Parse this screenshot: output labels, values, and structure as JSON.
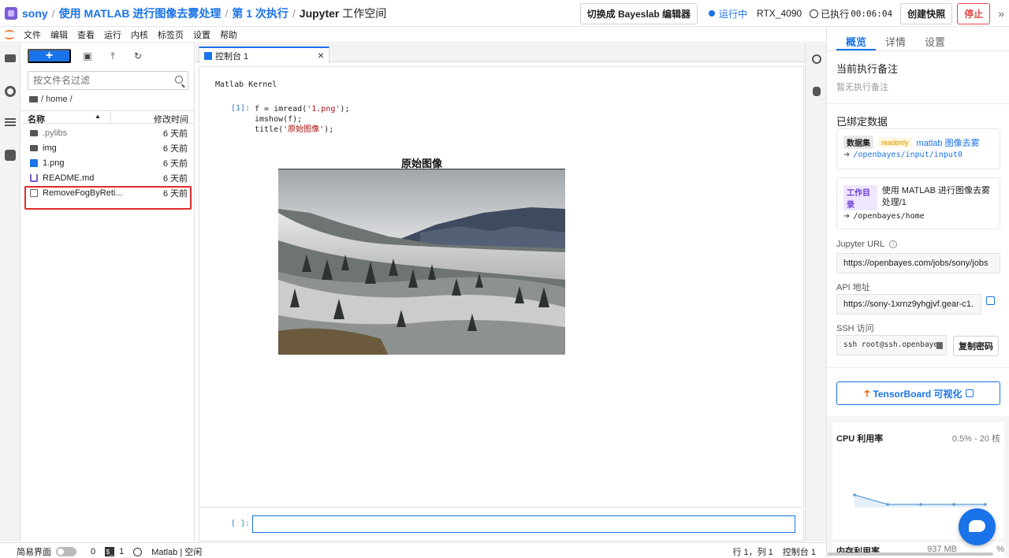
{
  "topbar": {
    "breadcrumb": {
      "user": "sony",
      "sep": "/",
      "project": "使用 MATLAB 进行图像去雾处理",
      "run": "第 1 次执行",
      "workspace_bold": "Jupyter",
      "workspace_rest": " 工作空间"
    },
    "switch_editor": "切换成 Bayeslab 编辑器",
    "status": "运行中",
    "gpu": "RTX_4090",
    "elapsed_label": "已执行",
    "elapsed_time": "00:06:04",
    "snapshot_btn": "创建快照",
    "stop_btn": "停止",
    "collapse": "»"
  },
  "menubar": [
    "文件",
    "编辑",
    "查看",
    "运行",
    "内核",
    "标签页",
    "设置",
    "帮助"
  ],
  "filebrowser": {
    "new_btn": "+",
    "search_placeholder": "按文件名过滤",
    "path": "/ home /",
    "col_name": "名称",
    "col_modified": "修改时间",
    "sort_glyph": "▲",
    "files": [
      {
        "name": ".pylibs",
        "modified": "6 天前",
        "type": "folder"
      },
      {
        "name": "img",
        "modified": "6 天前",
        "type": "folder"
      },
      {
        "name": "1.png",
        "modified": "6 天前",
        "type": "image"
      },
      {
        "name": "README.md",
        "modified": "6 天前",
        "type": "markdown"
      },
      {
        "name": "RemoveFogByReti...",
        "modified": "6 天前",
        "type": "file"
      }
    ]
  },
  "tabs": {
    "console_tab": "控制台 1",
    "close": "×"
  },
  "console": {
    "kernel": "Matlab Kernel",
    "prompt": "[1]:",
    "code": {
      "l1_a": "f = imread(",
      "l1_str": "'1.png'",
      "l1_b": ");",
      "l2": "imshow(f);",
      "l3_a": "title(",
      "l3_str": "'原始图像'",
      "l3_b": ");"
    },
    "figure_title": "原始图像",
    "input_prompt": "[ ]:"
  },
  "statusbar": {
    "simple_mode": "简易界面",
    "count_a": "0",
    "count_s": "1",
    "s_glyph": "$_",
    "kernel_state": "Matlab | 空闲",
    "cursor": "行 1，列 1",
    "console_name": "控制台 1"
  },
  "rightpanel": {
    "tabs": [
      "概览",
      "详情",
      "设置"
    ],
    "note_title": "当前执行备注",
    "note_empty": "暂无执行备注",
    "bound_title": "已绑定数据",
    "dataset_tag": "数据集",
    "readonly_tag": "readonly",
    "dataset_name": "matlab 图像去雾",
    "dataset_path": "/openbayes/input/input0",
    "workdir_tag": "工作目录",
    "workdir_name": "使用 MATLAB 进行图像去雾处理/1",
    "workdir_path": "/openbayes/home",
    "arrow": "➜",
    "jupyter_url_label": "Jupyter URL",
    "jupyter_url": "https://openbayes.com/jobs/sony/jobs",
    "api_label": "API 地址",
    "api_url": "https://sony-1xrnz9yhgjvf.gear-c1.",
    "ssh_label": "SSH 访问",
    "ssh_cmd": "ssh root@ssh.openbayes",
    "copy_pw": "复制密码",
    "tensorboard": "TensorBoard 可视化",
    "cpu_title": "CPU 利用率",
    "cpu_val": "0.5% - 20 核",
    "mem_title": "内存利用率",
    "mem_val": "937 MB",
    "mem_pct": "%"
  },
  "colors": {
    "accent": "#1a73e8",
    "stop": "#e04a4a",
    "highlight": "#e32b2b"
  }
}
